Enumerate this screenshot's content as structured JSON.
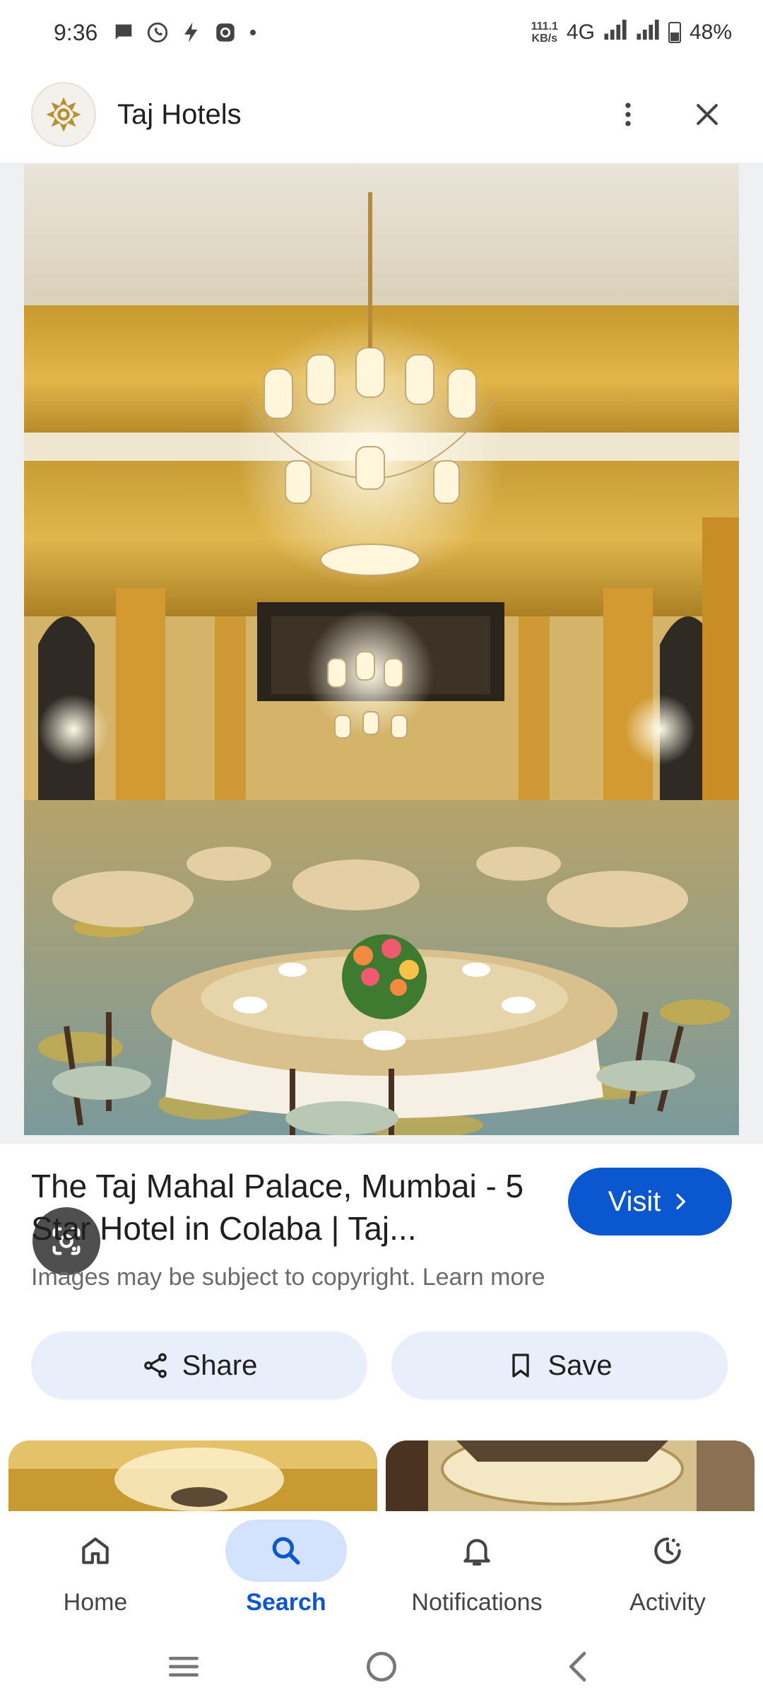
{
  "status_bar": {
    "time": "9:36",
    "net_speed_value": "111.1",
    "net_speed_unit": "KB/s",
    "network": "4G",
    "battery": "48%"
  },
  "header": {
    "site_name": "Taj Hotels"
  },
  "result": {
    "title": "The Taj Mahal Palace, Mumbai - 5 Star Hotel in Colaba | Taj...",
    "visit_label": "Visit",
    "copyright_text": "Images may be subject to copyright. Learn more"
  },
  "actions": {
    "share_label": "Share",
    "save_label": "Save"
  },
  "bottom_nav": {
    "items": [
      {
        "label": "Home",
        "icon": "home-icon"
      },
      {
        "label": "Search",
        "icon": "search-icon"
      },
      {
        "label": "Notifications",
        "icon": "bell-icon"
      },
      {
        "label": "Activity",
        "icon": "activity-icon"
      }
    ],
    "active": "Search"
  },
  "colors": {
    "accent": "#0b57d0",
    "action_bg": "#e8effb",
    "active_pill": "#d3e3fd"
  }
}
